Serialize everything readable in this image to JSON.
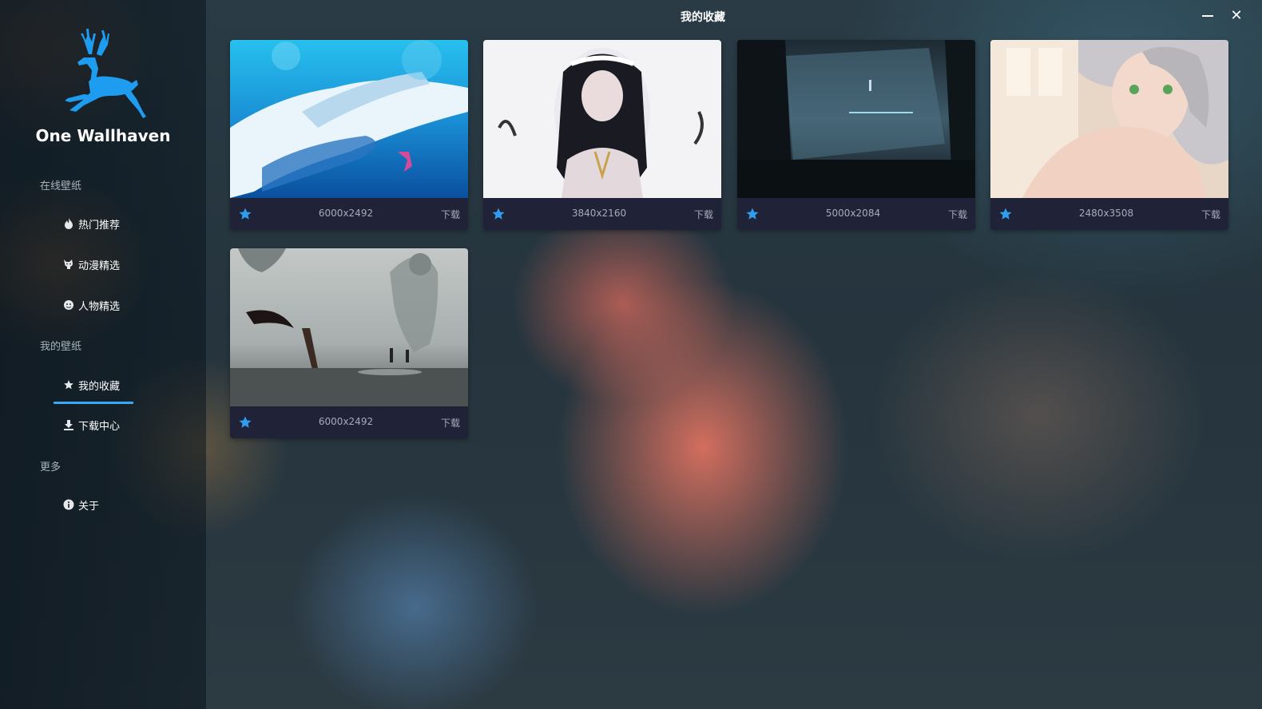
{
  "window": {
    "title": "我的收藏",
    "minimize_icon": "minimize-icon",
    "close_icon": "close-icon",
    "close_glyph": "✕"
  },
  "sidebar": {
    "app_name": "One Wallhaven",
    "logo_icon": "deer-logo",
    "accent_color": "#3aa9f5",
    "sections": [
      {
        "label": "在线壁纸",
        "items": [
          {
            "label": "热门推荐",
            "icon": "fire-icon"
          },
          {
            "label": "动漫精选",
            "icon": "cat-icon"
          },
          {
            "label": "人物精选",
            "icon": "person-icon"
          }
        ]
      },
      {
        "label": "我的壁纸",
        "items": [
          {
            "label": "我的收藏",
            "icon": "star-icon",
            "active": true
          },
          {
            "label": "下载中心",
            "icon": "download-icon"
          }
        ]
      },
      {
        "label": "更多",
        "items": [
          {
            "label": "关于",
            "icon": "info-icon"
          }
        ]
      }
    ]
  },
  "favorites": [
    {
      "resolution": "6000x2492",
      "download_label": "下载",
      "favorite_icon": "star-icon"
    },
    {
      "resolution": "3840x2160",
      "download_label": "下载",
      "favorite_icon": "star-icon"
    },
    {
      "resolution": "5000x2084",
      "download_label": "下载",
      "favorite_icon": "star-icon"
    },
    {
      "resolution": "2480x3508",
      "download_label": "下载",
      "favorite_icon": "star-icon"
    },
    {
      "resolution": "6000x2492",
      "download_label": "下载",
      "favorite_icon": "star-icon"
    }
  ]
}
